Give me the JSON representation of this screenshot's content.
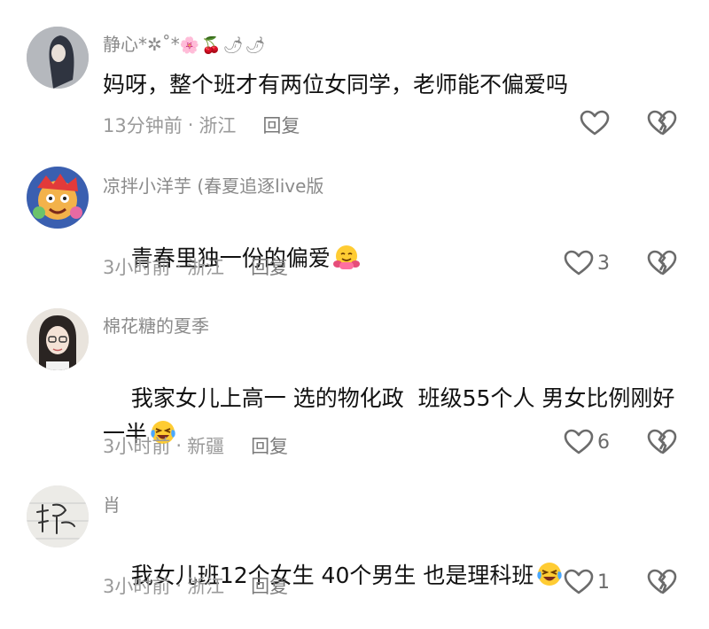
{
  "comments": [
    {
      "username": "静心*✲˚*",
      "username_emoji": "🌸🍒🌶🌶",
      "text": "妈呀，整个班才有两位女同学，老师能不偏爱吗",
      "time": "13分钟前",
      "location": "浙江",
      "reply_label": "回复",
      "likes": ""
    },
    {
      "username": "凉拌小洋芋 (春夏追逐live版",
      "text": "青春里独一份的偏爱",
      "inline_emoji": "hugging-face-emoji",
      "time": "3小时前",
      "location": "浙江",
      "reply_label": "回复",
      "likes": "3"
    },
    {
      "username": "棉花糖的夏季",
      "text": "我家女儿上高一 选的物化政  班级55个人 男女比例刚好一半",
      "inline_emoji": "laughing-crying-emoji",
      "time": "3小时前",
      "location": "新疆",
      "reply_label": "回复",
      "likes": "6"
    },
    {
      "username": "肖",
      "text": "我女儿班12个女生 40个男生 也是理科班",
      "inline_emoji": "laughing-crying-emoji",
      "time": "3小时前",
      "location": "浙江",
      "reply_label": "回复",
      "likes": "1"
    }
  ],
  "separator": "·",
  "colors": {
    "text": "#111111",
    "meta": "#9a9a9a",
    "username": "#8a8a8a",
    "icon": "#6b6b6b"
  }
}
